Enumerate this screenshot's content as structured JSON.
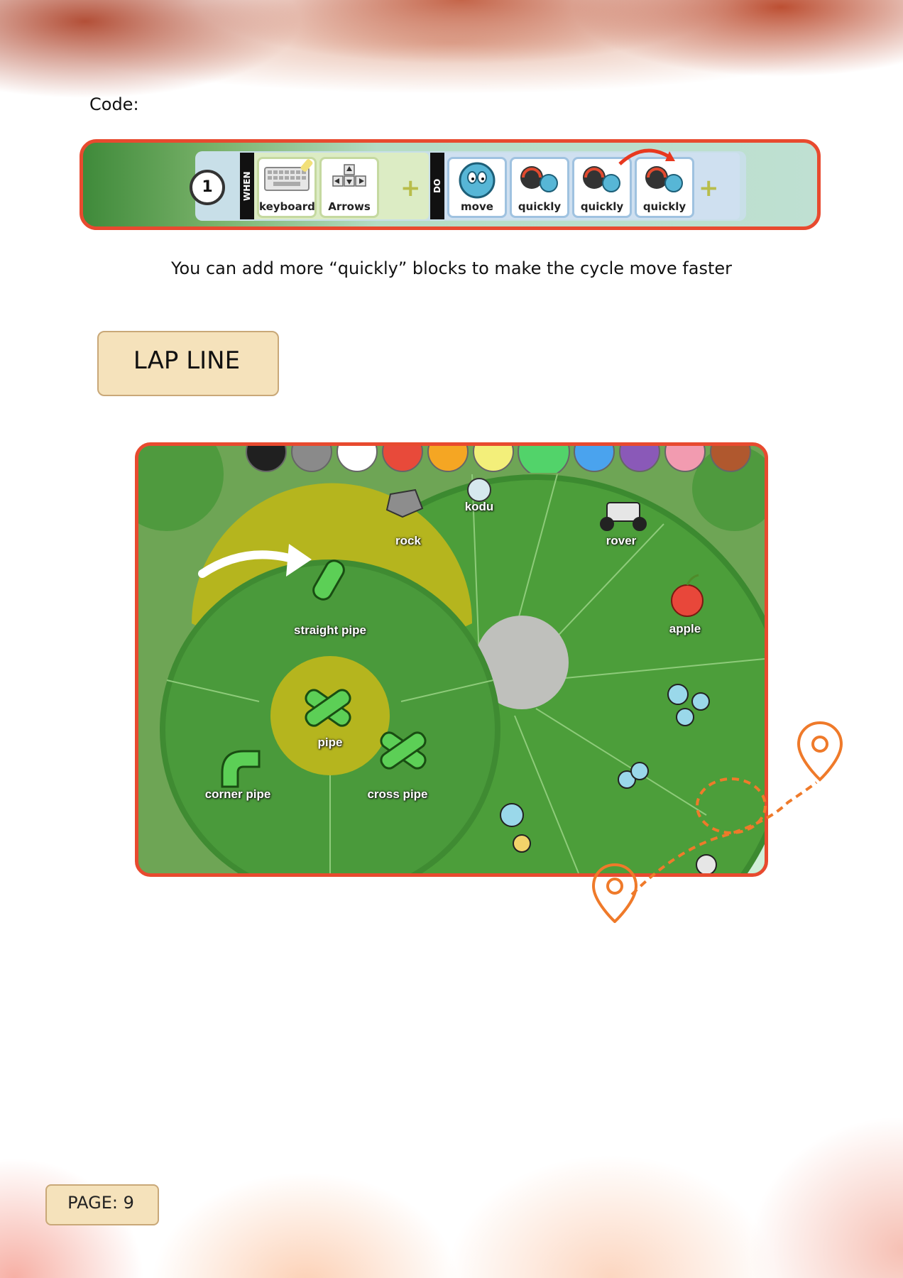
{
  "code_label": "Code:",
  "code_block": {
    "rule_number": "1",
    "when_label": "WHEN",
    "do_label": "DO",
    "when_tiles": [
      "keyboard",
      "Arrows"
    ],
    "do_tiles": [
      "move",
      "quickly",
      "quickly",
      "quickly"
    ]
  },
  "caption": "You can add more “quickly” blocks to make the cycle move faster",
  "section_title": "LAP LINE",
  "game_menu": {
    "outer_items": [
      "rock",
      "kodu",
      "rover",
      "apple"
    ],
    "pipe_items": [
      "straight pipe",
      "pipe",
      "corner pipe",
      "cross pipe"
    ],
    "colors": [
      "#202020",
      "#8a8a8a",
      "#ffffff",
      "#e84a3a",
      "#f5a623",
      "#f3ef7a",
      "#52d36a",
      "#4aa3ee",
      "#8a59b8",
      "#f29bb0",
      "#b0582e"
    ]
  },
  "page_label": "PAGE: 9"
}
